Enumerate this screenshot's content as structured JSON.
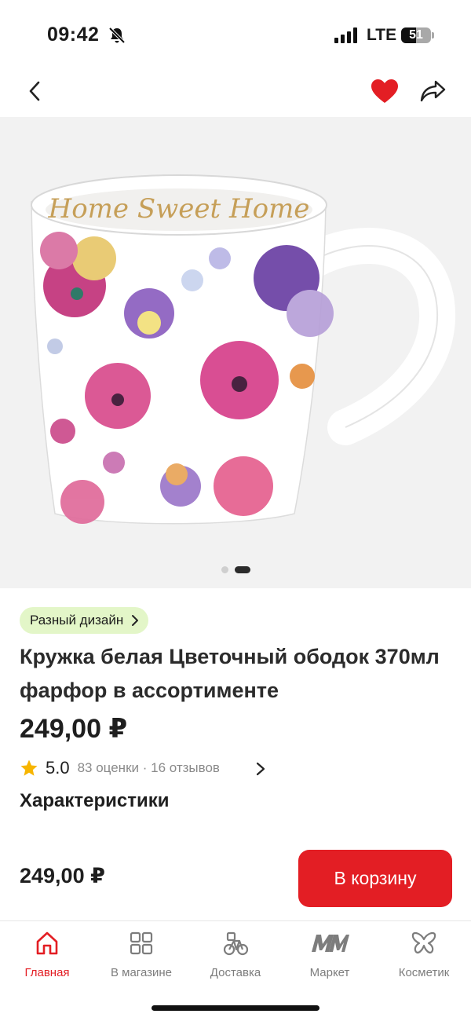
{
  "status_bar": {
    "time": "09:42",
    "network": "LTE",
    "battery": "51",
    "battery_level": 0.51
  },
  "header": {
    "back_icon": "chevron-left-icon",
    "favorite_icon": "heart-icon",
    "share_icon": "share-icon",
    "accent_color": "#e31e24"
  },
  "gallery": {
    "image_text": "Home Sweet Home",
    "pages": 2,
    "active_page": 2
  },
  "product": {
    "design_chip": "Разный дизайн",
    "title": "Кружка белая Цветочный ободок 370мл фарфор в ассортименте",
    "price": "249,00 ₽",
    "rating": "5.0",
    "rating_meta": "83 оценки · 16 отзывов",
    "specs_title": "Характеристики"
  },
  "buy_bar": {
    "price": "249,00 ₽",
    "cart_button": "В корзину"
  },
  "tabs": [
    {
      "label": "Главная",
      "icon": "home-icon",
      "active": true
    },
    {
      "label": "В магазине",
      "icon": "grid-icon",
      "active": false
    },
    {
      "label": "Доставка",
      "icon": "bicycle-icon",
      "active": false
    },
    {
      "label": "Маркет",
      "icon": "mm-logo-icon",
      "active": false
    },
    {
      "label": "Косметик",
      "icon": "butterfly-icon",
      "active": false
    }
  ]
}
